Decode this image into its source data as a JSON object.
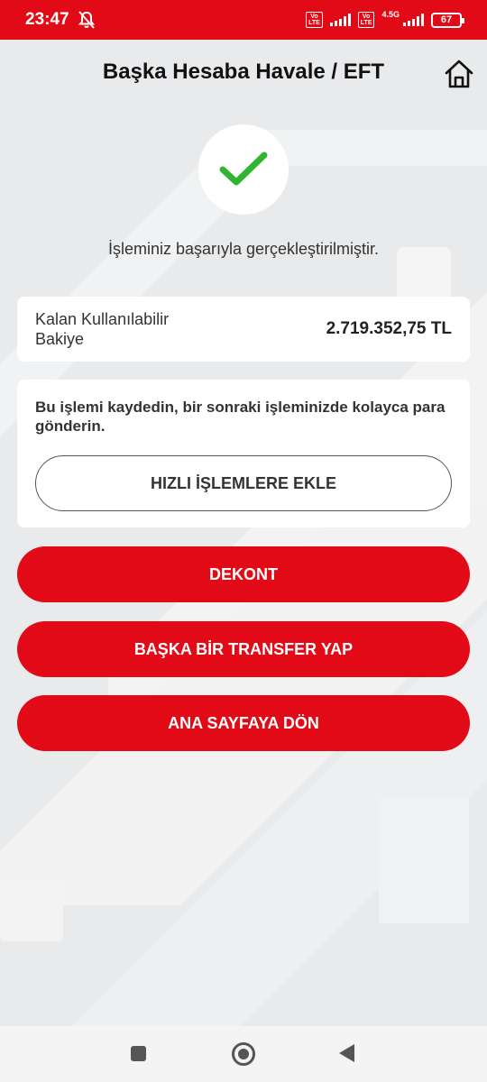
{
  "status_bar": {
    "time": "23:47",
    "volte_label": "Vo\nLTE",
    "network": "4.5G",
    "battery": "67"
  },
  "header": {
    "title": "Başka Hesaba Havale / EFT"
  },
  "success": {
    "message": "İşleminiz başarıyla gerçekleştirilmiştir."
  },
  "balance": {
    "label": "Kalan Kullanılabilir Bakiye",
    "value": "2.719.352,75 TL"
  },
  "save_card": {
    "text": "Bu işlemi kaydedin, bir sonraki işleminizde kolayca para gönderin.",
    "button_label": "HIZLI İŞLEMLERE EKLE"
  },
  "actions": {
    "dekont": "DEKONT",
    "transfer": "BAŞKA BİR TRANSFER YAP",
    "home": "ANA SAYFAYA DÖN"
  },
  "colors": {
    "brand_red": "#e30a17",
    "success_green": "#2fb52f"
  }
}
